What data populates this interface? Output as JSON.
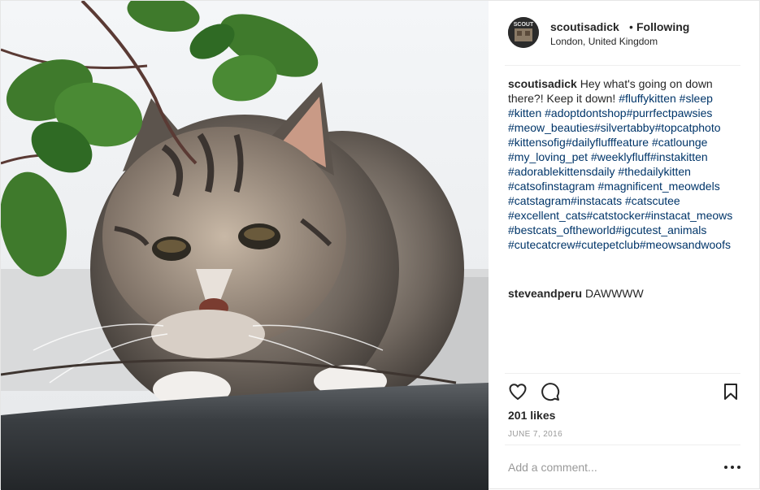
{
  "post": {
    "username": "scoutisadick",
    "follow_separator": "•",
    "follow_status": "Following",
    "location": "London, United Kingdom",
    "avatar_text": "SCOUT",
    "caption": {
      "username": "scoutisadick",
      "text": "Hey what's going on down there?! Keep it down!",
      "hashtags": [
        "#fluffykitten",
        "#sleep",
        "#kitten",
        "#adoptdontshop",
        "#purrfectpawsies",
        "#meow_beauties",
        "#silvertabby",
        "#topcatphoto",
        "#kittensofig",
        "#dailyflufffeature",
        "#catlounge",
        "#my_loving_pet",
        "#weeklyfluff",
        "#instakitten",
        "#adorablekittensdaily",
        "#thedailykitten",
        "#catsofinstagram",
        "#magnificent_meowdels",
        "#catstagram",
        "#instacats",
        "#catscutee",
        "#excellent_cats",
        "#catstocker",
        "#instacat_meows",
        "#bestcats_oftheworld",
        "#igcutest_animals",
        "#cutecatcrew",
        "#cutepetclub",
        "#meowsandwoofs"
      ]
    },
    "comments": [
      {
        "username": "steveandperu",
        "text": "DAWWWW"
      }
    ],
    "likes": "201 likes",
    "date": "JUNE 7, 2016",
    "add_comment_placeholder": "Add a comment...",
    "icons": {
      "like": "heart-icon",
      "comment": "comment-bubble-icon",
      "save": "bookmark-icon",
      "options": "more-options-icon"
    },
    "colors": {
      "text": "#262626",
      "hashtag": "#003569",
      "muted": "#999999",
      "divider": "#efefef"
    }
  }
}
